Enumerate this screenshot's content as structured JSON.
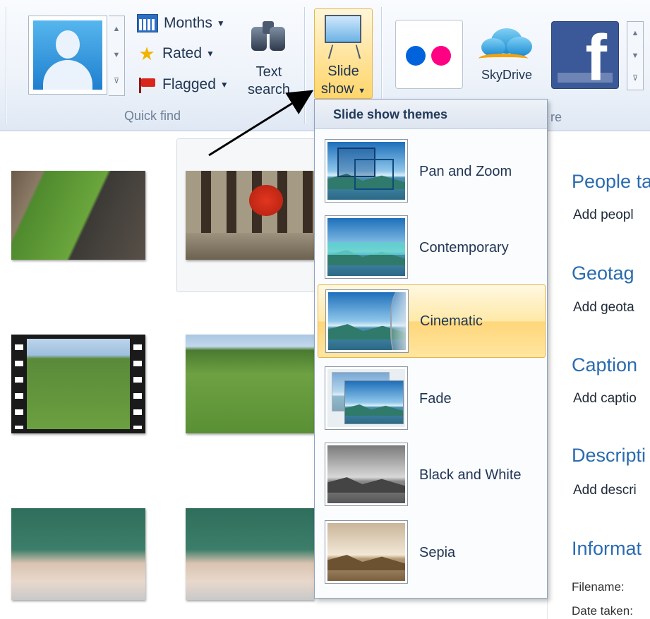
{
  "ribbon": {
    "quick_find": {
      "group_label": "Quick find",
      "months_label": "Months",
      "rated_label": "Rated",
      "flagged_label": "Flagged",
      "text_search_line1": "Text",
      "text_search_line2": "search"
    },
    "slideshow": {
      "line1": "Slide",
      "line2": "show"
    },
    "share": {
      "group_label_partial": "re",
      "skydrive_label": "SkyDrive",
      "flickr_colors": [
        "#0063dc",
        "#ff0084"
      ],
      "facebook_letter": "f"
    }
  },
  "dropdown": {
    "header": "Slide show themes",
    "items": [
      {
        "label": "Pan and Zoom",
        "selected": false
      },
      {
        "label": "Contemporary",
        "selected": false
      },
      {
        "label": "Cinematic",
        "selected": true
      },
      {
        "label": "Fade",
        "selected": false
      },
      {
        "label": "Black and White",
        "selected": false
      },
      {
        "label": "Sepia",
        "selected": false
      }
    ]
  },
  "details_pane": {
    "people_heading": "People ta",
    "people_link": "Add peopl",
    "geotag_heading": "Geotag",
    "geotag_link": "Add geota",
    "caption_heading": "Caption",
    "caption_link": "Add captio",
    "description_heading": "Descripti",
    "description_link": "Add descri",
    "information_heading": "Informat",
    "filename_label": "Filename:",
    "date_taken_label": "Date taken:"
  },
  "colors": {
    "highlight": "#ffe39a",
    "heading_blue": "#2a6bb0",
    "facebook_blue": "#3b5998"
  }
}
